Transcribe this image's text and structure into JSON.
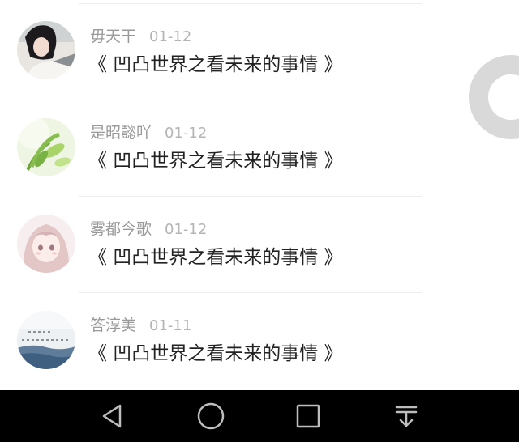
{
  "feed": {
    "items": [
      {
        "name": "毋天干",
        "date": "01-12",
        "title": "《 凹凸世界之看未来的事情 》",
        "avatar": "avatar-girl-photo"
      },
      {
        "name": "是昭懿吖",
        "date": "01-12",
        "title": "《 凹凸世界之看未来的事情 》",
        "avatar": "avatar-green-plant"
      },
      {
        "name": "雾都今歌",
        "date": "01-12",
        "title": "《 凹凸世界之看未来的事情 》",
        "avatar": "avatar-anime-girl"
      },
      {
        "name": "答淳美",
        "date": "01-11",
        "title": "《 凹凸世界之看未来的事情 》",
        "avatar": "avatar-sea-calligraphy"
      }
    ]
  },
  "navbar": {
    "icons": [
      "back-triangle-icon",
      "home-circle-icon",
      "recents-square-icon",
      "notification-pull-icon"
    ]
  },
  "colors": {
    "name_text": "#9a9a9a",
    "date_text": "#b4b4b4",
    "title_text": "#222222",
    "navbar_bg": "#000000",
    "nav_icon": "#bdbdbd"
  }
}
